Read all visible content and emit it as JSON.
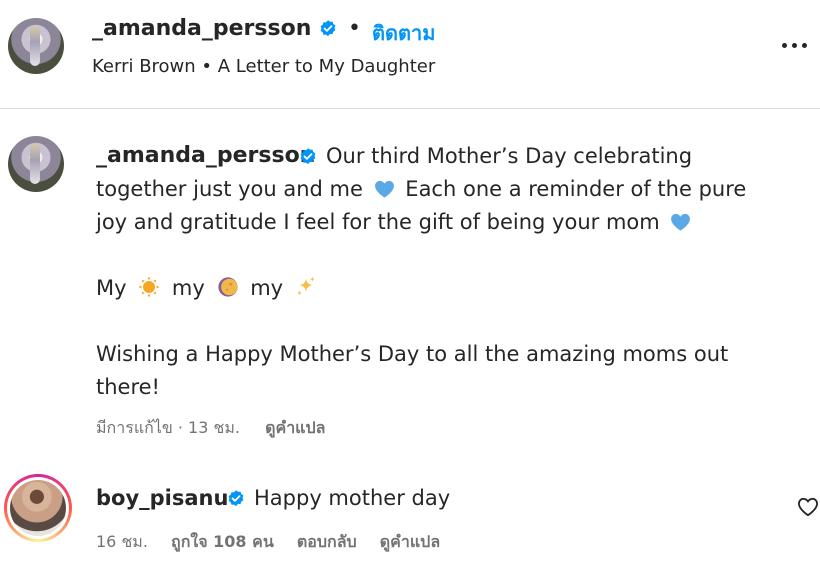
{
  "header": {
    "username": "_amanda_persson",
    "separator": "•",
    "follow_label": "ติดตาม",
    "audio": "Kerri Brown • A Letter to My Daughter"
  },
  "caption": {
    "username": "_amanda_persson",
    "line1_text": "Our third Mother’s Day celebrating",
    "line2_text": "together just you and me",
    "line2b_text": "Each one a reminder of the pure",
    "line3_text": "joy and gratitude I feel for the gift of being your mom",
    "line4_my1": "My",
    "line4_my2": "my",
    "line4_my3": "my",
    "line5_text": "Wishing a Happy Mother’s Day to all the amazing moms out",
    "line6_text": "there!",
    "edited_time": "มีการแก้ไข · 13 ชม.",
    "translate_label": "ดูคำแปล"
  },
  "comment": {
    "username": "boy_pisanu",
    "text": "Happy mother day",
    "time": "16 ชม.",
    "likes": "ถูกใจ 108 คน",
    "reply_label": "ตอบกลับ",
    "translate_label": "ดูคำแปล"
  },
  "colors": {
    "accent": "#0095f6",
    "verified": "#0095f6",
    "secondary_text": "#737373",
    "primary_text": "#262626",
    "heart_emoji": "#5aa9e6"
  },
  "icons": {
    "more": "more-horizontal-icon",
    "verified": "verified-badge-icon",
    "like": "heart-outline-icon",
    "blue_heart": "blue-heart-emoji",
    "sun": "sun-emoji",
    "moon": "moon-emoji",
    "sparkles": "sparkles-emoji"
  }
}
